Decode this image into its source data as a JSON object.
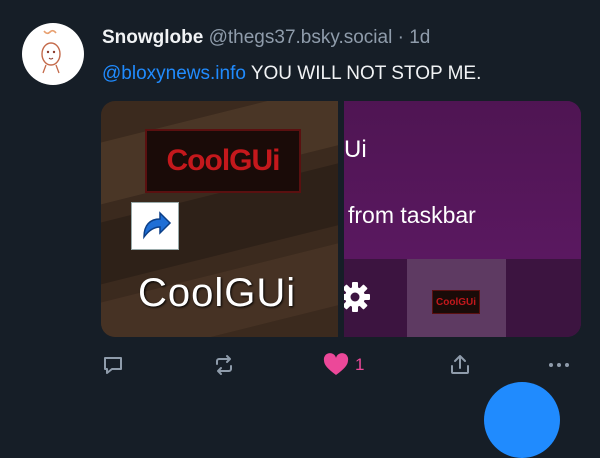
{
  "post": {
    "author_name": "Snowglobe",
    "author_handle": "@thegs37.bsky.social",
    "separator": "·",
    "time": "1d",
    "mention": "@bloxynews.info",
    "text": " YOU WILL NOT STOP ME.",
    "images": [
      {
        "logo_text": "CoolGUi",
        "shortcut_label": "CoolGUi"
      },
      {
        "ui_text": "Ui",
        "taskbar_text": "from taskbar",
        "thumb_logo_text": "CoolGUi"
      }
    ],
    "actions": {
      "like_count": "1"
    }
  },
  "colors": {
    "background": "#161e27",
    "accent": "#208bfe",
    "like": "#ec4899",
    "muted": "#8f9cab"
  },
  "icons": {
    "reply": "comment-icon",
    "repost": "repost-icon",
    "like": "heart-icon",
    "share": "share-icon",
    "more": "ellipsis-icon",
    "settings": "gear-icon"
  }
}
